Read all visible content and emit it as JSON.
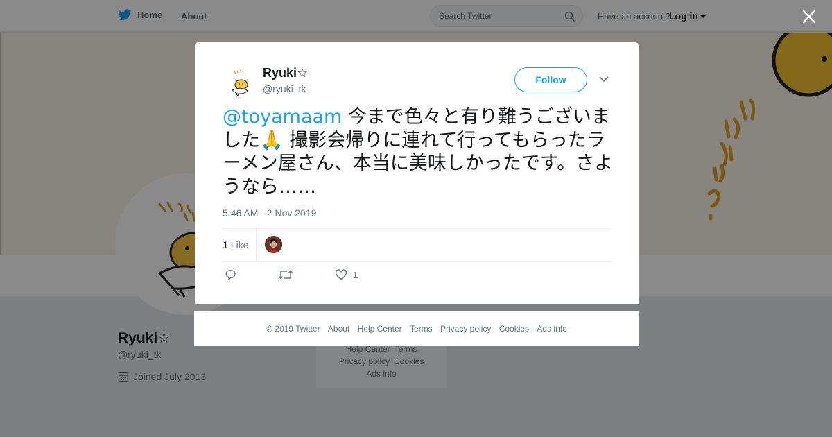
{
  "topbar": {
    "home_label": "Home",
    "about_label": "About",
    "search_placeholder": "Search Twitter",
    "have_account": "Have an account?",
    "login_label": "Log in"
  },
  "profile": {
    "name": "Ryuki☆",
    "handle": "@ryuki_tk",
    "joined": "Joined July 2013"
  },
  "side_footer": {
    "line1": [
      "Help Center",
      "Terms"
    ],
    "line2": [
      "Privacy policy",
      "Cookies"
    ],
    "line3": "Ads info"
  },
  "tweet": {
    "author_name": "Ryuki☆",
    "author_handle": "@ryuki_tk",
    "follow_label": "Follow",
    "mention": "@toyamaam",
    "text": " 今まで色々と有り難うございました🙏 撮影会帰りに連れて行ってもらったラーメン屋さん、本当に美味しかったです。さようなら……",
    "timestamp": "5:46 AM - 2 Nov 2019",
    "likes_count": "1",
    "likes_label": "Like",
    "like_action_count": "1"
  },
  "footer": {
    "copyright": "© 2019 Twitter",
    "about": "About",
    "help": "Help Center",
    "terms": "Terms",
    "privacy": "Privacy policy",
    "cookies": "Cookies",
    "ads": "Ads info"
  },
  "icons": {
    "brand": "twitter-bird-icon",
    "search": "search-icon",
    "close": "close-icon",
    "calendar": "calendar-icon",
    "reply": "reply-icon",
    "retweet": "retweet-icon",
    "like": "heart-icon",
    "more": "chevron-down-icon"
  },
  "colors": {
    "brand_blue": "#1da1f2",
    "text_secondary": "#657786"
  }
}
